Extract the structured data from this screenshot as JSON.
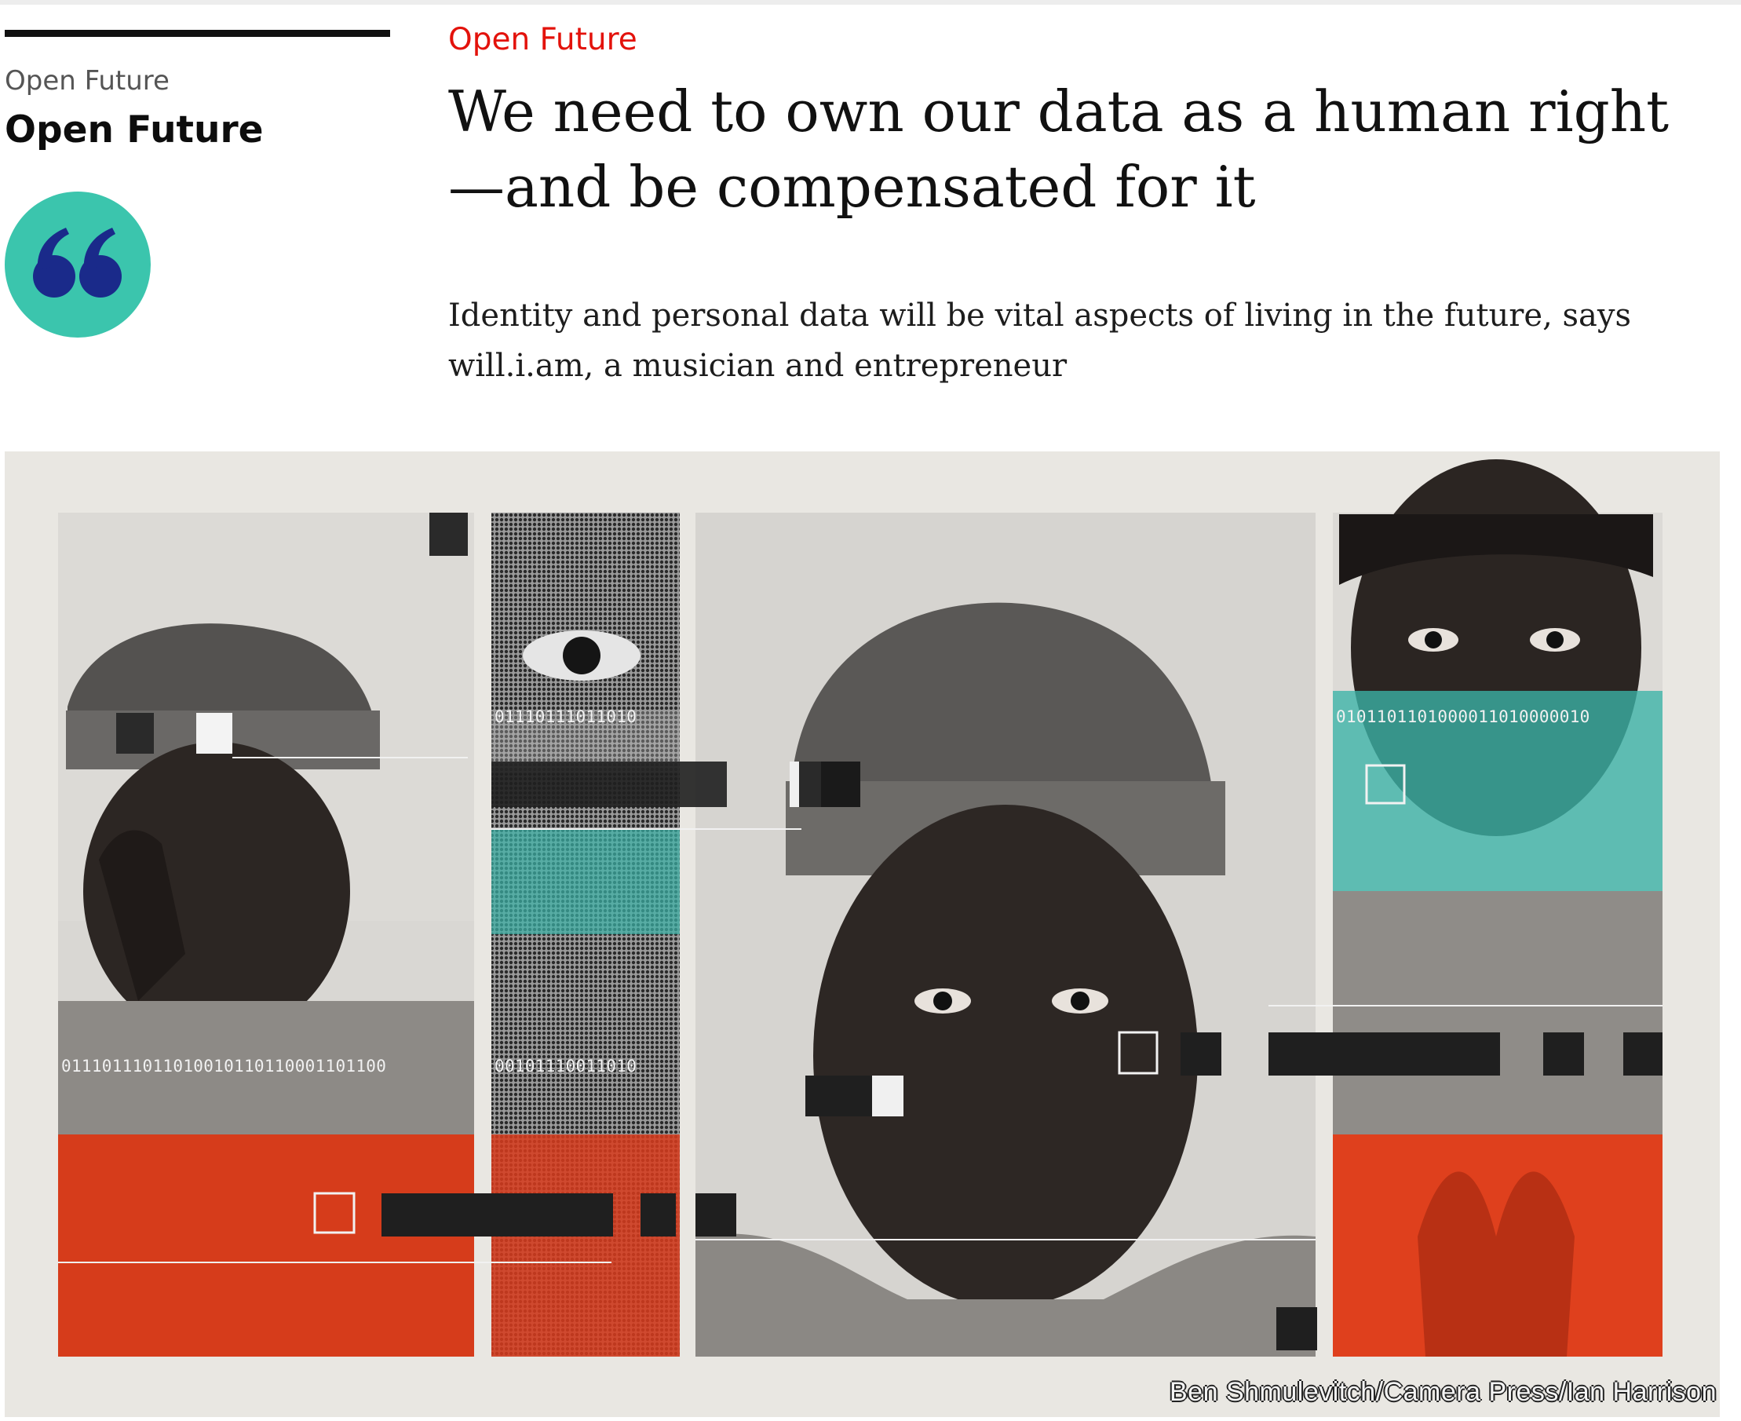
{
  "sidebar": {
    "kicker": "Open Future",
    "title": "Open Future",
    "badge_icon": "quotation-marks-icon",
    "badge_color": "#3bc5ad",
    "badge_icon_color": "#1a2a8a"
  },
  "article": {
    "kicker": "Open Future",
    "kicker_color": "#e3120b",
    "headline_line1": "We need to own our data as a human right",
    "headline_line2": "—and be compensated for it",
    "standfirst_line1": "Identity and personal data will be vital aspects of living in the future, says",
    "standfirst_line2": "will.i.am, a musician and entrepreneur"
  },
  "illustration": {
    "caption": "Ben Shmulevitch/Camera Press/Ian Harrison",
    "binary_1": "01110111011010",
    "binary_2": "0101101101000011010000010",
    "binary_3": "01110111011010010110110001101100",
    "binary_4": "00101110011010",
    "accent_colors": [
      "#e0411f",
      "#3bb4a8"
    ]
  }
}
